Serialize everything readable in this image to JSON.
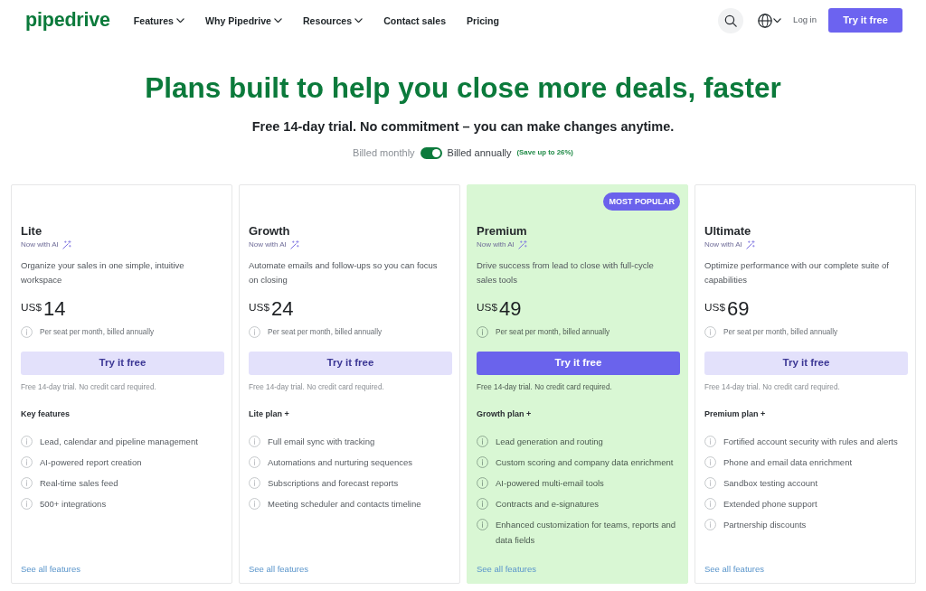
{
  "header": {
    "logo": "pipedrive",
    "nav": [
      {
        "label": "Features",
        "dropdown": true
      },
      {
        "label": "Why Pipedrive",
        "dropdown": true
      },
      {
        "label": "Resources",
        "dropdown": true
      },
      {
        "label": "Contact sales",
        "dropdown": false
      },
      {
        "label": "Pricing",
        "dropdown": false
      }
    ],
    "login": "Log in",
    "cta": "Try it free"
  },
  "hero": {
    "title": "Plans built to help you close more deals, faster",
    "subtitle": "Free 14-day trial. No commitment – you can make changes anytime.",
    "billing": {
      "monthly_label": "Billed monthly",
      "annual_label": "Billed annually",
      "annual": true,
      "savings": "(Save up to 26%)"
    }
  },
  "plans": [
    {
      "name": "Lite",
      "ai_note": "Now with AI",
      "description": "Organize your sales in one simple, intuitive workspace",
      "currency": "US$",
      "price": "14",
      "price_note": "Per seat per month, billed annually",
      "button": "Try it free",
      "trial_note": "Free 14-day trial. No credit card required.",
      "features_heading": "Key features",
      "features": [
        "Lead, calendar and pipeline management",
        "AI-powered report creation",
        "Real-time sales feed",
        "500+ integrations"
      ],
      "link": "See all features",
      "highlighted": false
    },
    {
      "name": "Growth",
      "ai_note": "Now with AI",
      "description": "Automate emails and follow-ups so you can focus on closing",
      "currency": "US$",
      "price": "24",
      "price_note": "Per seat per month, billed annually",
      "button": "Try it free",
      "trial_note": "Free 14-day trial. No credit card required.",
      "features_heading": "Lite plan +",
      "features": [
        "Full email sync with tracking",
        "Automations and nurturing sequences",
        "Subscriptions and forecast reports",
        "Meeting scheduler and contacts timeline"
      ],
      "link": "See all features",
      "highlighted": false
    },
    {
      "name": "Premium",
      "badge": "MOST POPULAR",
      "ai_note": "Now with AI",
      "description": "Drive success from lead to close with full-cycle sales tools",
      "currency": "US$",
      "price": "49",
      "price_note": "Per seat per month, billed annually",
      "button": "Try it free",
      "trial_note": "Free 14-day trial. No credit card required.",
      "features_heading": "Growth plan +",
      "features": [
        "Lead generation and routing",
        "Custom scoring and company data enrichment",
        "AI-powered multi-email tools",
        "Contracts and e-signatures",
        "Enhanced customization for teams, reports and data fields"
      ],
      "link": "See all features",
      "highlighted": true
    },
    {
      "name": "Ultimate",
      "ai_note": "Now with AI",
      "description": "Optimize performance with our complete suite of capabilities",
      "currency": "US$",
      "price": "69",
      "price_note": "Per seat per month, billed annually",
      "button": "Try it free",
      "trial_note": "Free 14-day trial. No credit card required.",
      "features_heading": "Premium plan +",
      "features": [
        "Fortified account security with rules and alerts",
        "Phone and email data enrichment",
        "Sandbox testing account",
        "Extended phone support",
        "Partnership discounts"
      ],
      "link": "See all features",
      "highlighted": false
    }
  ]
}
